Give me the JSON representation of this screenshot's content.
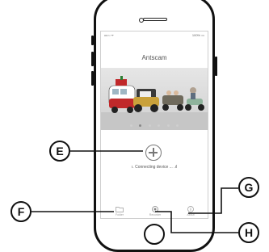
{
  "status_bar": {
    "left": "•••○○ ᯤ",
    "right": "100% ▭"
  },
  "app": {
    "title": "Antscam"
  },
  "banner": {
    "slides": 6,
    "active_slide": 2
  },
  "main": {
    "connection_status": "Connecting device ..."
  },
  "tabs": [
    {
      "label": "Folder",
      "icon": "folder-icon"
    },
    {
      "label": "Recorder",
      "icon": "camera-icon"
    },
    {
      "label": "About",
      "icon": "info-icon"
    }
  ],
  "callouts": {
    "e": "E",
    "f": "F",
    "g": "G",
    "h": "H"
  },
  "colors": {
    "phone_frame": "#111111",
    "screen_border": "#cfcfcf",
    "icon_gray": "#777777"
  }
}
